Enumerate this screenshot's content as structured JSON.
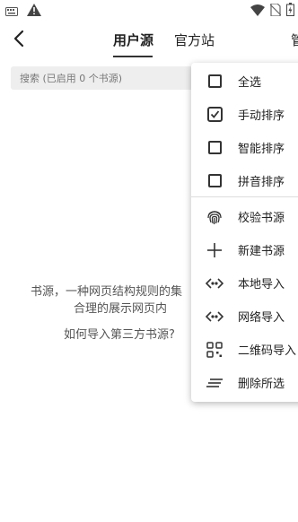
{
  "status_bar": {
    "left_icons": [
      "keyboard-icon",
      "warning-icon"
    ],
    "right_icons": [
      "wifi-icon",
      "no-sim-icon",
      "battery-icon"
    ]
  },
  "toolbar": {
    "tabs": [
      {
        "label": "用户源",
        "active": true
      },
      {
        "label": "官方站",
        "active": false
      },
      {
        "label": "管",
        "active": false
      }
    ]
  },
  "search": {
    "placeholder": "搜索 (已启用 0 个书源)"
  },
  "empty_state": {
    "line1": "书源，一种网页结构规则的集",
    "line2": "合理的展示网页内",
    "import_link": "如何导入第三方书源?"
  },
  "menu": {
    "items": [
      {
        "label": "全选",
        "icon": "checkbox-empty-icon",
        "checked": false
      },
      {
        "label": "手动排序",
        "icon": "checkbox-checked-icon",
        "checked": true
      },
      {
        "label": "智能排序",
        "icon": "checkbox-empty-icon",
        "checked": false
      },
      {
        "label": "拼音排序",
        "icon": "checkbox-empty-icon",
        "checked": false
      },
      {
        "label": "校验书源",
        "icon": "fingerprint-icon"
      },
      {
        "label": "新建书源",
        "icon": "plus-icon"
      },
      {
        "label": "本地导入",
        "icon": "code-icon"
      },
      {
        "label": "网络导入",
        "icon": "code-icon"
      },
      {
        "label": "二维码导入",
        "icon": "qr-code-icon"
      },
      {
        "label": "删除所选",
        "icon": "delete-lines-icon"
      }
    ]
  },
  "colors": {
    "accent": "#333333",
    "search_bg": "#eeeeee",
    "menu_bg": "#ffffff"
  }
}
